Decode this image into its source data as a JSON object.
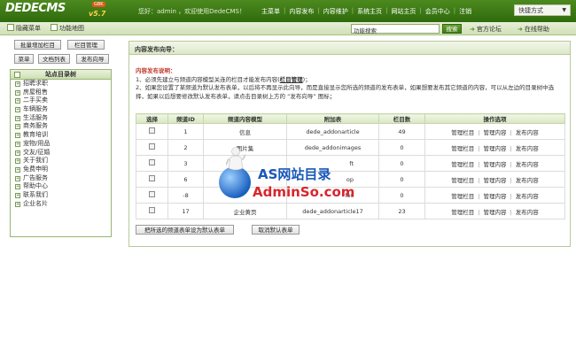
{
  "app": {
    "logo": "DEDECMS",
    "version": "v5.7",
    "badge": "GBK"
  },
  "header": {
    "welcome": "您好：admin ，欢迎使用DedeCMS！",
    "nav": [
      "主菜单",
      "内容发布",
      "内容维护",
      "系统主页",
      "网站主页",
      "会员中心",
      "注销"
    ],
    "quick_mode": "快捷方式"
  },
  "subbar": {
    "hide_menu": "隐藏菜单",
    "function_map": "功能地图",
    "search_value": "功能搜索",
    "search_button": "搜索",
    "forum": "官方论坛",
    "help": "在线帮助"
  },
  "sidebar": {
    "buttons": [
      "批量增加栏目",
      "栏目管理",
      "菜单",
      "文档列表",
      "发布向导"
    ],
    "tree_title": "站点目录树",
    "items": [
      "招聘求职",
      "房屋租售",
      "二手买卖",
      "车辆服务",
      "生活服务",
      "商务服务",
      "教育培训",
      "宠物/用品",
      "交友/征婚",
      "关于我们",
      "免费申明",
      "广告服务",
      "帮助中心",
      "联系我们",
      "企业名片"
    ]
  },
  "main": {
    "title": "内容发布向导：",
    "desc_title": "内容发布说明：",
    "desc_line1_a": "1、必须先建立与频道内容模型关连的栏目才能发布内容(",
    "desc_line1_link": "栏目管理",
    "desc_line1_b": ")；",
    "desc_line2": "2、如果您设置了某频道为默认发布表单，以后将不再显示此向导，而是直接显示您所选的频道的发布表单，如果想要发布其它频道的内容，可以从左边的目录树中选择，如果以后想要修改默认发布表单，请点击目录树上方的 “发布向导” 图标；",
    "table": {
      "headers": [
        "选择",
        "频道ID",
        "频道内容模型",
        "附加表",
        "栏目数",
        "操作选项"
      ],
      "rows": [
        {
          "id": "1",
          "model": "信息",
          "addtable": "dede_addonarticle",
          "count": "49"
        },
        {
          "id": "2",
          "model": "图片集",
          "addtable": "dede_addonimages",
          "count": "0"
        },
        {
          "id": "3",
          "model": "",
          "addtable": "ft",
          "count": "0"
        },
        {
          "id": "6",
          "model": "",
          "addtable": "op",
          "count": "0"
        },
        {
          "id": "-8",
          "model": "",
          "addtable": "fos",
          "count": "0"
        },
        {
          "id": "17",
          "model": "企业黄页",
          "addtable": "dede_addonarticle17",
          "count": "23"
        }
      ],
      "ops": [
        "管理栏目",
        "管理内容",
        "发布内容"
      ]
    },
    "btn_set_default": "把所选的频道表单设为默认表单",
    "btn_cancel_default": "取消默认表单"
  },
  "watermark": {
    "line1": "AS网站目录",
    "line2": "AdminSo.com"
  },
  "colors": {
    "brand_green": "#3f7a14",
    "watermark_blue": "#1a58b8",
    "watermark_red": "#d8262d"
  }
}
